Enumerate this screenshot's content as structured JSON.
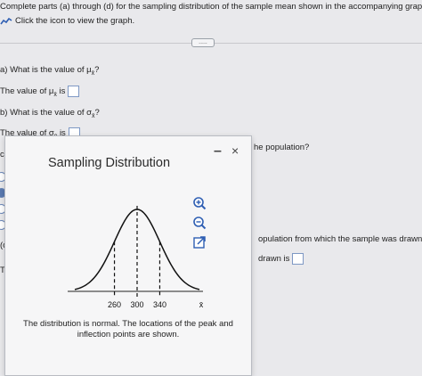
{
  "header": {
    "instruction": "Complete parts (a) through (d) for the sampling distribution of the sample mean shown in the accompanying graph.",
    "icon_hint": "Click the icon to view the graph.",
    "more_label": "....."
  },
  "questions": {
    "a_prompt": "a) What is the value of μ",
    "a_sub": "x̄",
    "a_end": "?",
    "a_answer_pre": "The value of μ",
    "a_answer_sub": "x̄",
    "a_answer_post": "is",
    "b_prompt": "b) What is the value of σ",
    "b_sub": "x̄",
    "b_end": "?",
    "b_answer_pre": "The value of σ",
    "b_answer_sub": "x̄",
    "b_answer_post": "is",
    "c_label": "c",
    "c_tail": "he population?",
    "d_label": "(c",
    "d_tail": "opulation from which the sample was drawn?",
    "d_answer_tail": "drawn is",
    "t_label": "Th"
  },
  "popup": {
    "title": "Sampling Distribution",
    "minimize": "–",
    "close": "×",
    "caption": "The distribution is normal. The locations of the peak and inflection points are shown."
  },
  "chart_data": {
    "type": "line",
    "title": "",
    "xlabel": "x̄",
    "ylabel": "",
    "distribution": "normal",
    "mean": 300,
    "sd": 40,
    "tick_labels": [
      "260",
      "300",
      "340"
    ],
    "ticks": [
      260,
      300,
      340
    ],
    "xlim": [
      190,
      410
    ]
  }
}
